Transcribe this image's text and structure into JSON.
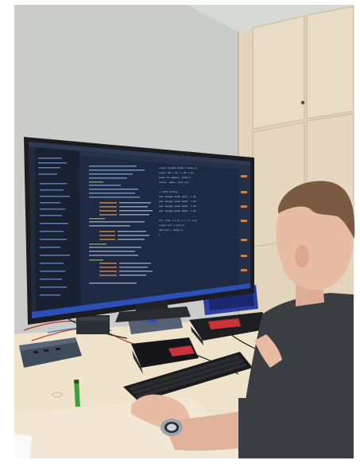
{
  "photo": {
    "subject": "person at desk",
    "colors": {
      "wall": "#c9ccc9",
      "cabinet": "#e3d5bd",
      "desk": "#efe3cc",
      "monitor_bezel": "#1b1d22",
      "editor_bg": "#1e2a44",
      "sidebar_bg": "#1a2133",
      "shirt": "#3a3d42",
      "hair": "#7a5a40",
      "skin": "#e8bca3",
      "accent_red": "#c8343a",
      "accent_blue": "#2d4fb8"
    }
  },
  "screen": {
    "title_bar": "",
    "editor_lines": [
      "const target_mode = make_t(",
      "  layer.w0 = 10, r.s0 = 11,",
      "  path.t0_sample, mode_t,",
      "  count, data, next_ptr,",
      "",
      "// 0x0 config",
      "  set target_mode 0x31 -> 0x",
      "  set target_mode 0x32 -> 0x",
      "  set target_mode 0x33 -> 0x",
      "  set target_mode 0x34 -> 0x",
      "",
      "for (let i = 0; i < n; i++)",
      "  const src = arr[i]",
      "  emit(src, mode_t)",
      "}"
    ]
  }
}
